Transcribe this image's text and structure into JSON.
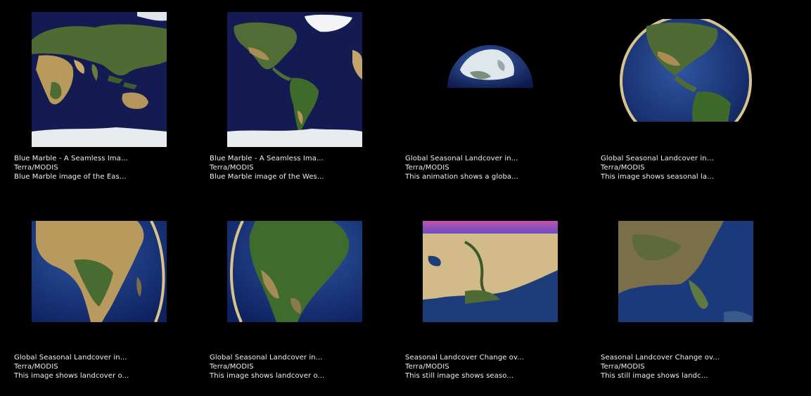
{
  "gallery": {
    "items": [
      {
        "title": "Blue Marble - A Seamless Ima...",
        "instrument": "Terra/MODIS",
        "description": "Blue Marble image of the Eas...",
        "icon": "eastern-hemisphere-map-thumbnail"
      },
      {
        "title": "Blue Marble - A Seamless Ima...",
        "instrument": "Terra/MODIS",
        "description": "Blue Marble image of the Wes...",
        "icon": "western-hemisphere-map-thumbnail"
      },
      {
        "title": "Global Seasonal Landcover in...",
        "instrument": "Terra/MODIS",
        "description": "This animation shows a globa...",
        "icon": "arctic-globe-thumbnail"
      },
      {
        "title": "Global Seasonal Landcover in...",
        "instrument": "Terra/MODIS",
        "description": "This image shows seasonal la...",
        "icon": "americas-globe-thumbnail"
      },
      {
        "title": "Global Seasonal Landcover in...",
        "instrument": "Terra/MODIS",
        "description": "This image shows landcover o...",
        "icon": "africa-globe-thumbnail"
      },
      {
        "title": "Global Seasonal Landcover in...",
        "instrument": "Terra/MODIS",
        "description": "This image shows landcover o...",
        "icon": "south-america-globe-thumbnail"
      },
      {
        "title": "Seasonal Landcover Change ov...",
        "instrument": "Terra/MODIS",
        "description": "This still image shows seaso...",
        "icon": "nile-valley-oblique-thumbnail"
      },
      {
        "title": "Seasonal Landcover Change ov...",
        "instrument": "Terra/MODIS",
        "description": "This still image shows landc...",
        "icon": "southeast-us-thumbnail"
      }
    ]
  },
  "colors": {
    "background": "#000000",
    "text": "#f0f0f0",
    "ocean": "#141a52",
    "land": "#4a6a2e",
    "desert": "#c9b07a"
  }
}
